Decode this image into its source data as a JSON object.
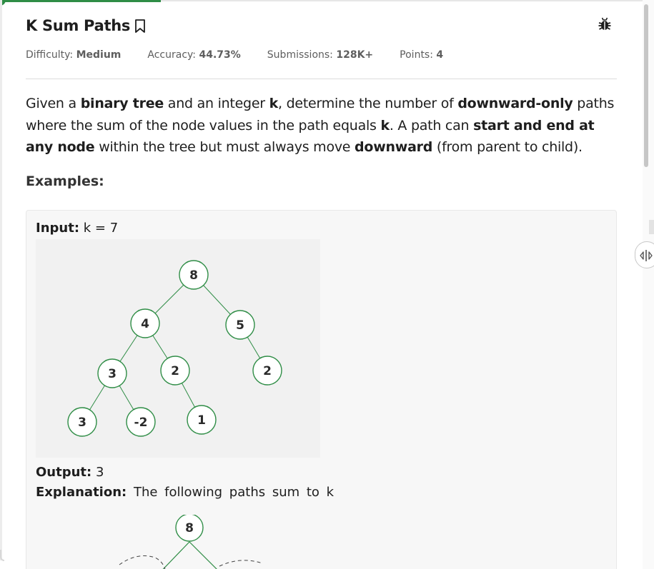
{
  "problem": {
    "title": "K Sum Paths",
    "meta": {
      "difficulty_label": "Difficulty:",
      "difficulty_value": "Medium",
      "accuracy_label": "Accuracy:",
      "accuracy_value": "44.73%",
      "submissions_label": "Submissions:",
      "submissions_value": "128K+",
      "points_label": "Points:",
      "points_value": "4"
    },
    "statement": {
      "p1": "Given a ",
      "b1": "binary tree",
      "p2": " and an integer ",
      "b2": "k",
      "p3": ", determine the number of ",
      "b3": "downward-only",
      "p4": " paths where the sum of the node values in the path equals ",
      "b4": "k",
      "p5": ". A path can ",
      "b5": "start and end at any node",
      "p6": " within the tree but must always move ",
      "b6": "downward",
      "p7": " (from parent to child)."
    },
    "examples_heading": "Examples:"
  },
  "example": {
    "input_label": "Input:",
    "input_value": "k = 7",
    "output_label": "Output:",
    "output_value": "3",
    "explanation_label": "Explanation:",
    "explanation_value": "The following paths sum to k",
    "tree_nodes": [
      "8",
      "4",
      "5",
      "3",
      "2",
      "2",
      "3",
      "-2",
      "1"
    ],
    "tree2_root": "8"
  },
  "icons": {
    "bookmark": "bookmark-icon",
    "bug": "bug-icon",
    "split": "split-handle-icon"
  },
  "colors": {
    "accent": "#2f8d46",
    "node_border": "#2f8d46",
    "edge": "#2f8d46"
  }
}
